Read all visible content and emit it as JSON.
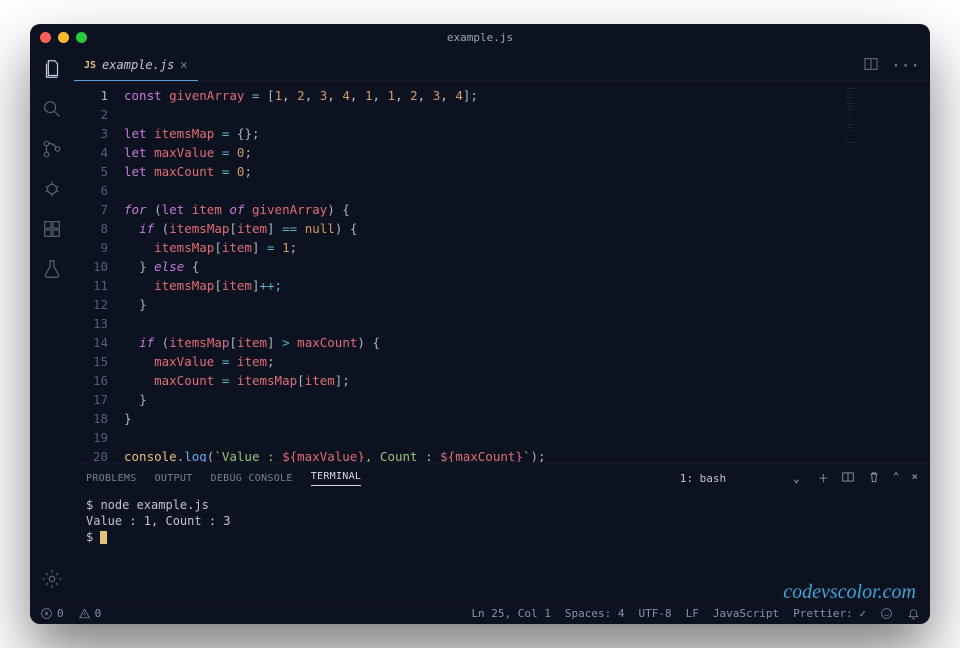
{
  "title": "example.js",
  "tab": {
    "icon": "JS",
    "label": "example.js"
  },
  "gutterLines": [
    "1",
    "2",
    "3",
    "4",
    "5",
    "6",
    "7",
    "8",
    "9",
    "10",
    "11",
    "12",
    "13",
    "14",
    "15",
    "16",
    "17",
    "18",
    "19",
    "20"
  ],
  "code": {
    "l1a": "const",
    "l1b": "givenArray",
    "l1c": "=",
    "l1d": "[",
    "l1n1": "1",
    "l1n2": "2",
    "l1n3": "3",
    "l1n4": "4",
    "l1n5": "1",
    "l1n6": "1",
    "l1n7": "2",
    "l1n8": "3",
    "l1n9": "4",
    "l1e": "];",
    "l3a": "let",
    "l3b": "itemsMap",
    "l3c": "=",
    "l3d": "{};",
    "l4a": "let",
    "l4b": "maxValue",
    "l4c": "=",
    "l4d": "0",
    "l4e": ";",
    "l5a": "let",
    "l5b": "maxCount",
    "l5c": "=",
    "l5d": "0",
    "l5e": ";",
    "l7a": "for",
    "l7b": "(",
    "l7c": "let",
    "l7d": "item",
    "l7e": "of",
    "l7f": "givenArray",
    "l7g": ") {",
    "l8a": "if",
    "l8b": "(",
    "l8c": "itemsMap",
    "l8d": "[",
    "l8e": "item",
    "l8f": "]",
    "l8g": "==",
    "l8h": "null",
    "l8i": ") {",
    "l9a": "itemsMap",
    "l9b": "[",
    "l9c": "item",
    "l9d": "]",
    "l9e": "=",
    "l9f": "1",
    "l9g": ";",
    "l10a": "}",
    "l10b": "else",
    "l10c": "{",
    "l11a": "itemsMap",
    "l11b": "[",
    "l11c": "item",
    "l11d": "]",
    "l11e": "++;",
    "l12a": "}",
    "l14a": "if",
    "l14b": "(",
    "l14c": "itemsMap",
    "l14d": "[",
    "l14e": "item",
    "l14f": "]",
    "l14g": ">",
    "l14h": "maxCount",
    "l14i": ") {",
    "l15a": "maxValue",
    "l15b": "=",
    "l15c": "item",
    "l15d": ";",
    "l16a": "maxCount",
    "l16b": "=",
    "l16c": "itemsMap",
    "l16d": "[",
    "l16e": "item",
    "l16f": "];",
    "l17a": "}",
    "l18a": "}",
    "l20a": "console",
    "l20b": ".",
    "l20c": "log",
    "l20d": "(",
    "l20e": "`Value : ",
    "l20f": "${",
    "l20g": "maxValue",
    "l20h": "}",
    "l20i": ", Count : ",
    "l20j": "${",
    "l20k": "maxCount",
    "l20l": "}",
    "l20m": "`",
    "l20n": ");"
  },
  "panel": {
    "tabs": {
      "problems": "PROBLEMS",
      "output": "OUTPUT",
      "debug": "DEBUG CONSOLE",
      "terminal": "TERMINAL"
    },
    "shell": "1: bash"
  },
  "terminal": {
    "l1": "$ node example.js",
    "l2": "Value : 1, Count : 3",
    "l3": "$ "
  },
  "watermark": "codevscolor.com",
  "status": {
    "errors": "0",
    "warnings": "0",
    "pos": "Ln 25, Col 1",
    "spaces": "Spaces: 4",
    "encoding": "UTF-8",
    "eol": "LF",
    "lang": "JavaScript",
    "prettier": "Prettier: ✓"
  }
}
